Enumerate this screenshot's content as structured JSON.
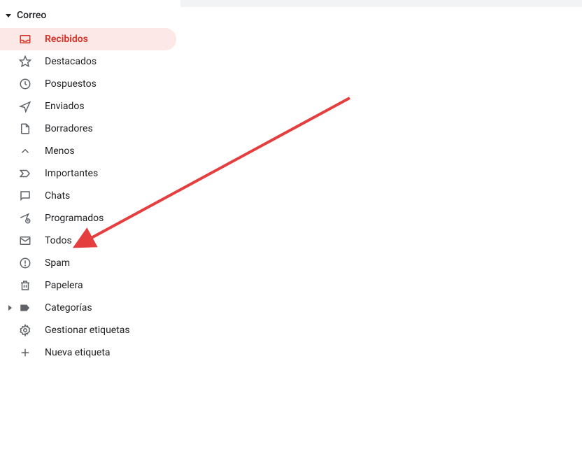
{
  "section": {
    "title": "Correo"
  },
  "sidebar": {
    "items": [
      {
        "label": "Recibidos"
      },
      {
        "label": "Destacados"
      },
      {
        "label": "Pospuestos"
      },
      {
        "label": "Enviados"
      },
      {
        "label": "Borradores"
      },
      {
        "label": "Menos"
      },
      {
        "label": "Importantes"
      },
      {
        "label": "Chats"
      },
      {
        "label": "Programados"
      },
      {
        "label": "Todos"
      },
      {
        "label": "Spam"
      },
      {
        "label": "Papelera"
      },
      {
        "label": "Categorías"
      },
      {
        "label": "Gestionar etiquetas"
      },
      {
        "label": "Nueva etiqueta"
      }
    ]
  },
  "annotation": {
    "arrow_color": "#e53e3e",
    "target": "todos"
  }
}
